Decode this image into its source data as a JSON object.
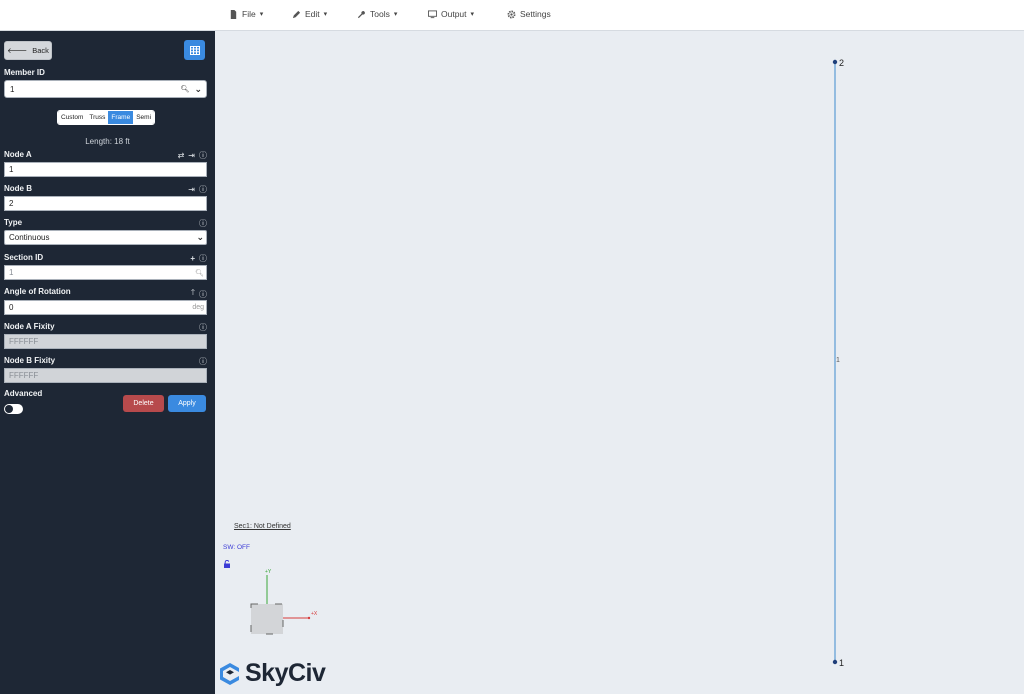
{
  "menu": {
    "file": "File",
    "edit": "Edit",
    "tools": "Tools",
    "output": "Output",
    "settings": "Settings"
  },
  "sidebar": {
    "back_label": "Back",
    "member_id_label": "Member ID",
    "member_id_value": "1",
    "segments": [
      "Custom",
      "Truss",
      "Frame",
      "Semi"
    ],
    "active_segment": "Frame",
    "length_label": "Length:",
    "length_value": "18 ft",
    "node_a_label": "Node A",
    "node_a_value": "1",
    "node_b_label": "Node B",
    "node_b_value": "2",
    "type_label": "Type",
    "type_value": "Continuous",
    "section_id_label": "Section ID",
    "section_id_placeholder": "1",
    "angle_label": "Angle of Rotation",
    "angle_value": "0",
    "angle_unit": "deg",
    "node_a_fixity_label": "Node A Fixity",
    "node_a_fixity_value": "FFFFFF",
    "node_b_fixity_label": "Node B Fixity",
    "node_b_fixity_value": "FFFFFF",
    "advanced_label": "Advanced",
    "delete_label": "Delete",
    "apply_label": "Apply"
  },
  "canvas": {
    "node_top_label": "2",
    "node_bottom_label": "1",
    "member_label": "1",
    "section_label": "Sec1: Not Defined",
    "sw_label": "SW: OFF",
    "axis_y_label": "+Y",
    "axis_x_label": "+X",
    "member_color": "#5b9bd5",
    "node_color": "#1f3f7a"
  },
  "brand": {
    "name": "SkyCiv"
  },
  "colors": {
    "accent": "#3a8ae0",
    "danger": "#b74a4c",
    "sidebar_bg": "#1e2735"
  }
}
